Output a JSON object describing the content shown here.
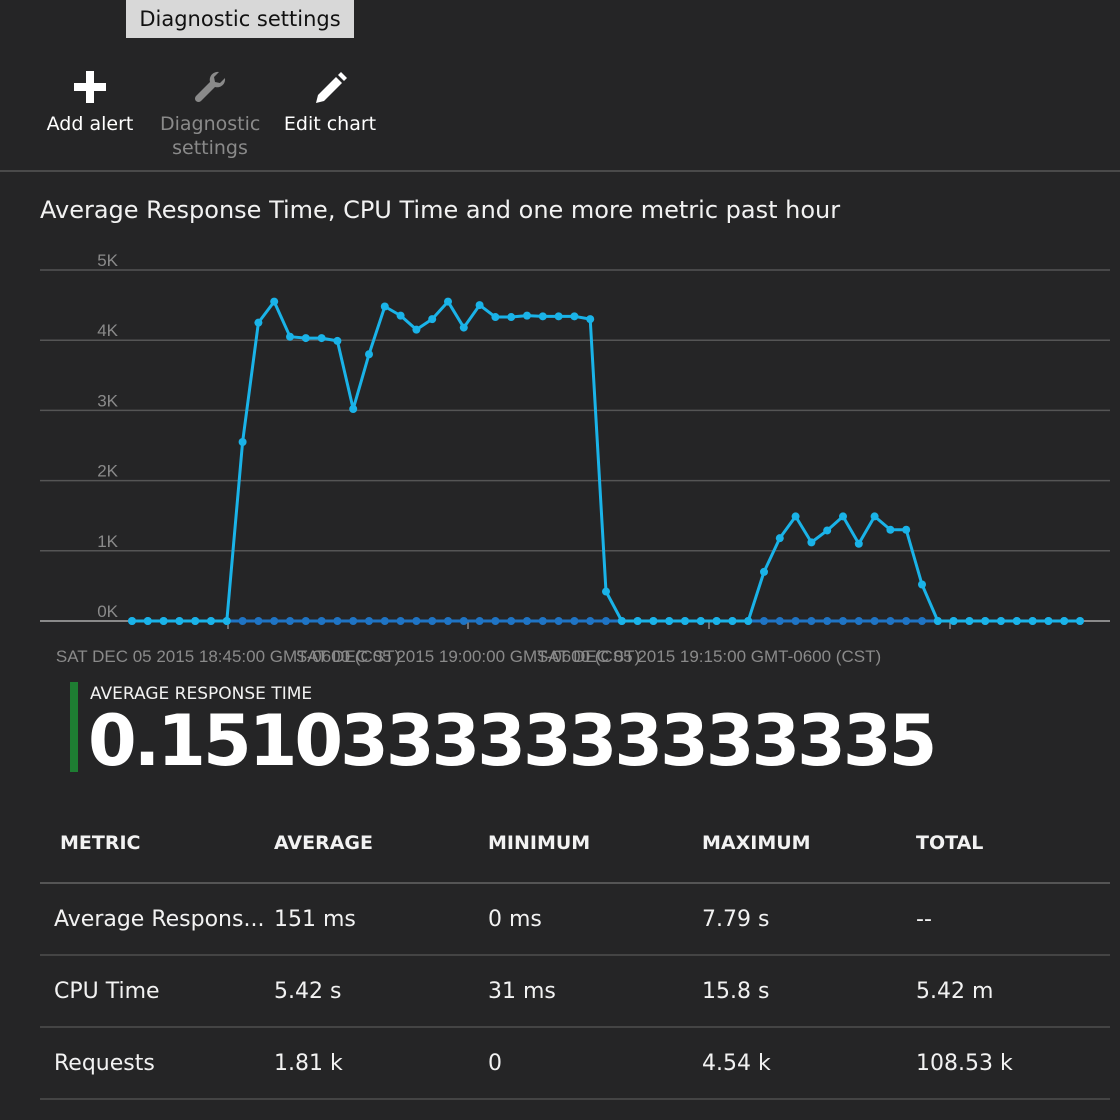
{
  "tooltip": {
    "text": "Diagnostic settings"
  },
  "toolbar": {
    "add_alert": "Add alert",
    "diagnostic_settings": "Diagnostic settings",
    "edit_chart": "Edit chart"
  },
  "chart_title": "Average Response Time, CPU Time and one more metric past hour",
  "chart_data": {
    "type": "line",
    "title": "Average Response Time, CPU Time and one more metric past hour",
    "ylim": [
      0,
      5000
    ],
    "yticks": [
      0,
      1000,
      2000,
      3000,
      4000,
      5000
    ],
    "ytick_labels": [
      "0K",
      "1K",
      "2K",
      "3K",
      "4K",
      "5K"
    ],
    "xlim": [
      0,
      60
    ],
    "x_tick_labels": [
      "SAT DEC 05 2015 18:45:00 GMT-0600 (CST)",
      "SAT DEC 05 2015 19:00:00 GMT-0600 (CST)",
      "SAT DEC 05 2015 19:15:00 GMT-0600 (CST)"
    ],
    "grid": true,
    "legend": "none",
    "series": [
      {
        "color": "#1ab3e8",
        "values": [
          0,
          0,
          0,
          0,
          0,
          0,
          0,
          2550,
          4250,
          4550,
          4050,
          4030,
          4030,
          3990,
          3020,
          3800,
          4480,
          4350,
          4150,
          4300,
          4550,
          4180,
          4500,
          4330,
          4330,
          4350,
          4340,
          4340,
          4340,
          4300,
          420,
          0,
          0,
          0,
          0,
          0,
          0,
          0,
          0,
          0,
          700,
          1180,
          1490,
          1120,
          1290,
          1490,
          1100,
          1490,
          1300,
          1300,
          520,
          0,
          0,
          0,
          0,
          0,
          0,
          0,
          0,
          0,
          0
        ]
      },
      {
        "color": "#1f74c4",
        "values": [
          0,
          0,
          0,
          0,
          0,
          0,
          0,
          0,
          0,
          0,
          0,
          0,
          0,
          0,
          0,
          0,
          0,
          0,
          0,
          0,
          0,
          0,
          0,
          0,
          0,
          0,
          0,
          0,
          0,
          0,
          0,
          0,
          0,
          0,
          0,
          0,
          0,
          0,
          0,
          0,
          0,
          0,
          0,
          0,
          0,
          0,
          0,
          0,
          0,
          0,
          0,
          0,
          0,
          0,
          0,
          0,
          0,
          0,
          0,
          0,
          0
        ]
      }
    ]
  },
  "summary": {
    "label": "AVERAGE RESPONSE TIME",
    "value": "0.15103333333333335",
    "accent": "#1e7d32"
  },
  "table": {
    "headers": [
      "METRIC",
      "AVERAGE",
      "MINIMUM",
      "MAXIMUM",
      "TOTAL"
    ],
    "rows": [
      [
        "Average Respons...",
        "151 ms",
        "0 ms",
        "7.79 s",
        "--"
      ],
      [
        "CPU Time",
        "5.42 s",
        "31 ms",
        "15.8 s",
        "5.42 m"
      ],
      [
        "Requests",
        "1.81 k",
        "0",
        "4.54 k",
        "108.53 k"
      ]
    ]
  }
}
